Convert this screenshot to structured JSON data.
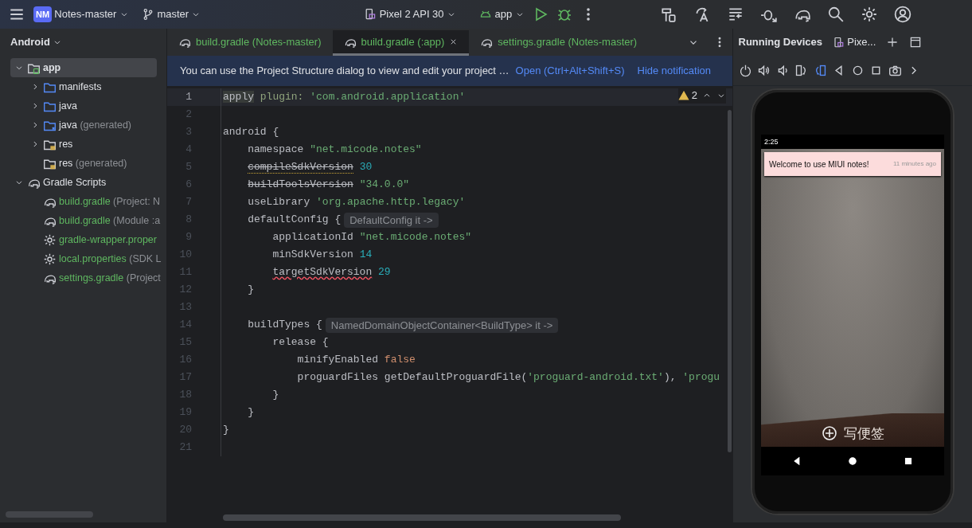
{
  "toolbar": {
    "project_badge": "NM",
    "project": "Notes-master",
    "branch": "master",
    "device": "Pixel 2 API 30",
    "run_config": "app"
  },
  "project_panel": {
    "view": "Android",
    "tree": [
      {
        "label": "app",
        "kind": "module",
        "expanded": true,
        "selected": true,
        "modified": false,
        "children": [
          {
            "label": "manifests",
            "kind": "folder",
            "expanded": false,
            "selected": false,
            "modified": false
          },
          {
            "label": "java",
            "kind": "folder",
            "expanded": false,
            "selected": false,
            "modified": false
          },
          {
            "label": "java",
            "hint": "(generated)",
            "kind": "generated",
            "expanded": false,
            "selected": false,
            "modified": false
          },
          {
            "label": "res",
            "kind": "resources",
            "expanded": false,
            "selected": false,
            "modified": false
          },
          {
            "label": "res",
            "hint": "(generated)",
            "kind": "resources",
            "selected": false,
            "modified": false
          }
        ]
      },
      {
        "label": "Gradle Scripts",
        "kind": "gradle",
        "expanded": true,
        "selected": false,
        "modified": false,
        "children": [
          {
            "label": "build.gradle",
            "hint": "(Project: N",
            "kind": "gradle",
            "selected": false,
            "modified": true
          },
          {
            "label": "build.gradle",
            "hint": "(Module :a",
            "kind": "gradle",
            "selected": false,
            "modified": true
          },
          {
            "label": "gradle-wrapper.proper",
            "kind": "properties",
            "selected": false,
            "modified": true
          },
          {
            "label": "local.properties",
            "hint": "(SDK L",
            "kind": "properties",
            "selected": false,
            "modified": true
          },
          {
            "label": "settings.gradle",
            "hint": "(Project",
            "kind": "gradle",
            "selected": false,
            "modified": true
          }
        ]
      }
    ]
  },
  "editor_tabs": [
    {
      "label": "build.gradle (Notes-master)",
      "selected": false
    },
    {
      "label": "build.gradle (:app)",
      "selected": true
    },
    {
      "label": "settings.gradle (Notes-master)",
      "selected": false
    }
  ],
  "notification": {
    "text": "You can use the Project Structure dialog to view and edit your project …",
    "action": "Open (Ctrl+Alt+Shift+S)",
    "dismiss": "Hide notification"
  },
  "inspections": {
    "warnings": "2"
  },
  "code": [
    {
      "number": "1",
      "current": true,
      "tokens": [
        {
          "text": "apply",
          "kind": "highlight"
        },
        {
          "text": " plugin: ",
          "kind": "param"
        },
        {
          "text": "'com.android.application'",
          "kind": "string"
        }
      ]
    },
    {
      "number": "2",
      "current": false
    },
    {
      "number": "3",
      "current": false,
      "tokens": [
        {
          "text": "android {",
          "kind": "plain"
        }
      ]
    },
    {
      "number": "4",
      "current": false,
      "tokens": [
        {
          "text": "namespace ",
          "kind": "plain"
        },
        {
          "text": "\"net.micode.notes\"",
          "kind": "string"
        }
      ]
    },
    {
      "number": "5",
      "current": false,
      "tokens": [
        {
          "text": "compileSdkVersion",
          "kind": "deprecated-warning"
        },
        {
          "text": " 30",
          "kind": "number"
        }
      ]
    },
    {
      "number": "6",
      "current": false,
      "tokens": [
        {
          "text": "buildToolsVersion",
          "kind": "deprecated"
        },
        {
          "text": " \"34.0.0\"",
          "kind": "string"
        }
      ]
    },
    {
      "number": "7",
      "current": false,
      "tokens": [
        {
          "text": "useLibrary ",
          "kind": "plain"
        },
        {
          "text": "'org.apache.http.legacy'",
          "kind": "string"
        }
      ]
    },
    {
      "number": "8",
      "current": false,
      "tokens": [
        {
          "text": "defaultConfig {",
          "kind": "plain"
        },
        {
          "text": "DefaultConfig it ->",
          "kind": "hint"
        }
      ]
    },
    {
      "number": "9",
      "current": false,
      "tokens": [
        {
          "text": "applicationId ",
          "kind": "plain"
        },
        {
          "text": "\"net.micode.notes\"",
          "kind": "string"
        }
      ]
    },
    {
      "number": "10",
      "current": false,
      "tokens": [
        {
          "text": "minSdkVersion ",
          "kind": "plain"
        },
        {
          "text": "14",
          "kind": "number"
        }
      ]
    },
    {
      "number": "11",
      "current": false,
      "tokens": [
        {
          "text": "targetSdkVersion",
          "kind": "error"
        },
        {
          "text": " 29",
          "kind": "number"
        }
      ]
    },
    {
      "number": "12",
      "current": false,
      "tokens": [
        {
          "text": "}",
          "kind": "plain"
        }
      ]
    },
    {
      "number": "13",
      "current": false
    },
    {
      "number": "14",
      "current": false,
      "tokens": [
        {
          "text": "buildTypes {",
          "kind": "plain"
        },
        {
          "text": "NamedDomainObjectContainer<BuildType> it ->",
          "kind": "hint"
        }
      ]
    },
    {
      "number": "15",
      "current": false,
      "tokens": [
        {
          "text": "release {",
          "kind": "plain"
        }
      ]
    },
    {
      "number": "16",
      "current": false,
      "tokens": [
        {
          "text": "minifyEnabled ",
          "kind": "plain"
        },
        {
          "text": "false",
          "kind": "keyword"
        }
      ]
    },
    {
      "number": "17",
      "current": false,
      "tokens": [
        {
          "text": "proguardFiles getDefaultProguardFile(",
          "kind": "plain"
        },
        {
          "text": "'proguard-android.txt'",
          "kind": "string"
        },
        {
          "text": "), ",
          "kind": "plain"
        },
        {
          "text": "'progu",
          "kind": "string"
        }
      ]
    },
    {
      "number": "18",
      "current": false,
      "tokens": [
        {
          "text": "}",
          "kind": "plain"
        }
      ]
    },
    {
      "number": "19",
      "current": false,
      "tokens": [
        {
          "text": "}",
          "kind": "plain"
        }
      ]
    },
    {
      "number": "20",
      "current": false,
      "tokens": [
        {
          "text": "}",
          "kind": "plain"
        }
      ]
    },
    {
      "number": "21",
      "current": false
    }
  ],
  "running_devices": {
    "title": "Running Devices",
    "device_tab": "Pixe...",
    "phone": {
      "time": "2:25",
      "note": {
        "title": "Welcome to use MIUI notes!",
        "time": "11 minutes ago"
      },
      "new_note": "写便签"
    }
  }
}
